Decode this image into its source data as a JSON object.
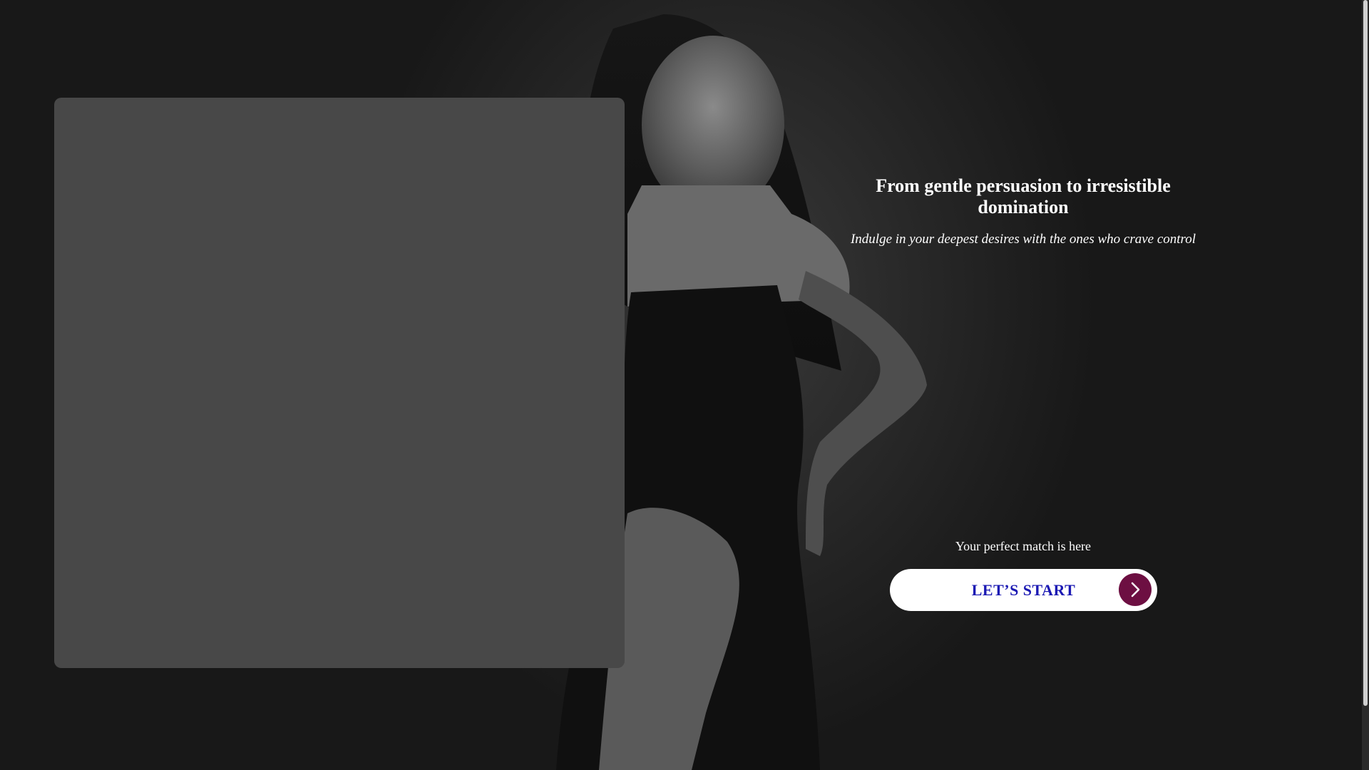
{
  "hero": {
    "headline": "From gentle persuasion to irresistible domination",
    "subheadline": "Indulge in your deepest desires with the ones who crave control",
    "match_text": "Your perfect match is here",
    "cta_label": "LET’S START",
    "cta_icon": "chevron-right-icon"
  },
  "colors": {
    "cta_text": "#1b19b3",
    "cta_arrow_bg": "#6d0f42",
    "panel_bg": "#484848",
    "page_bg": "#1c1c1c"
  }
}
